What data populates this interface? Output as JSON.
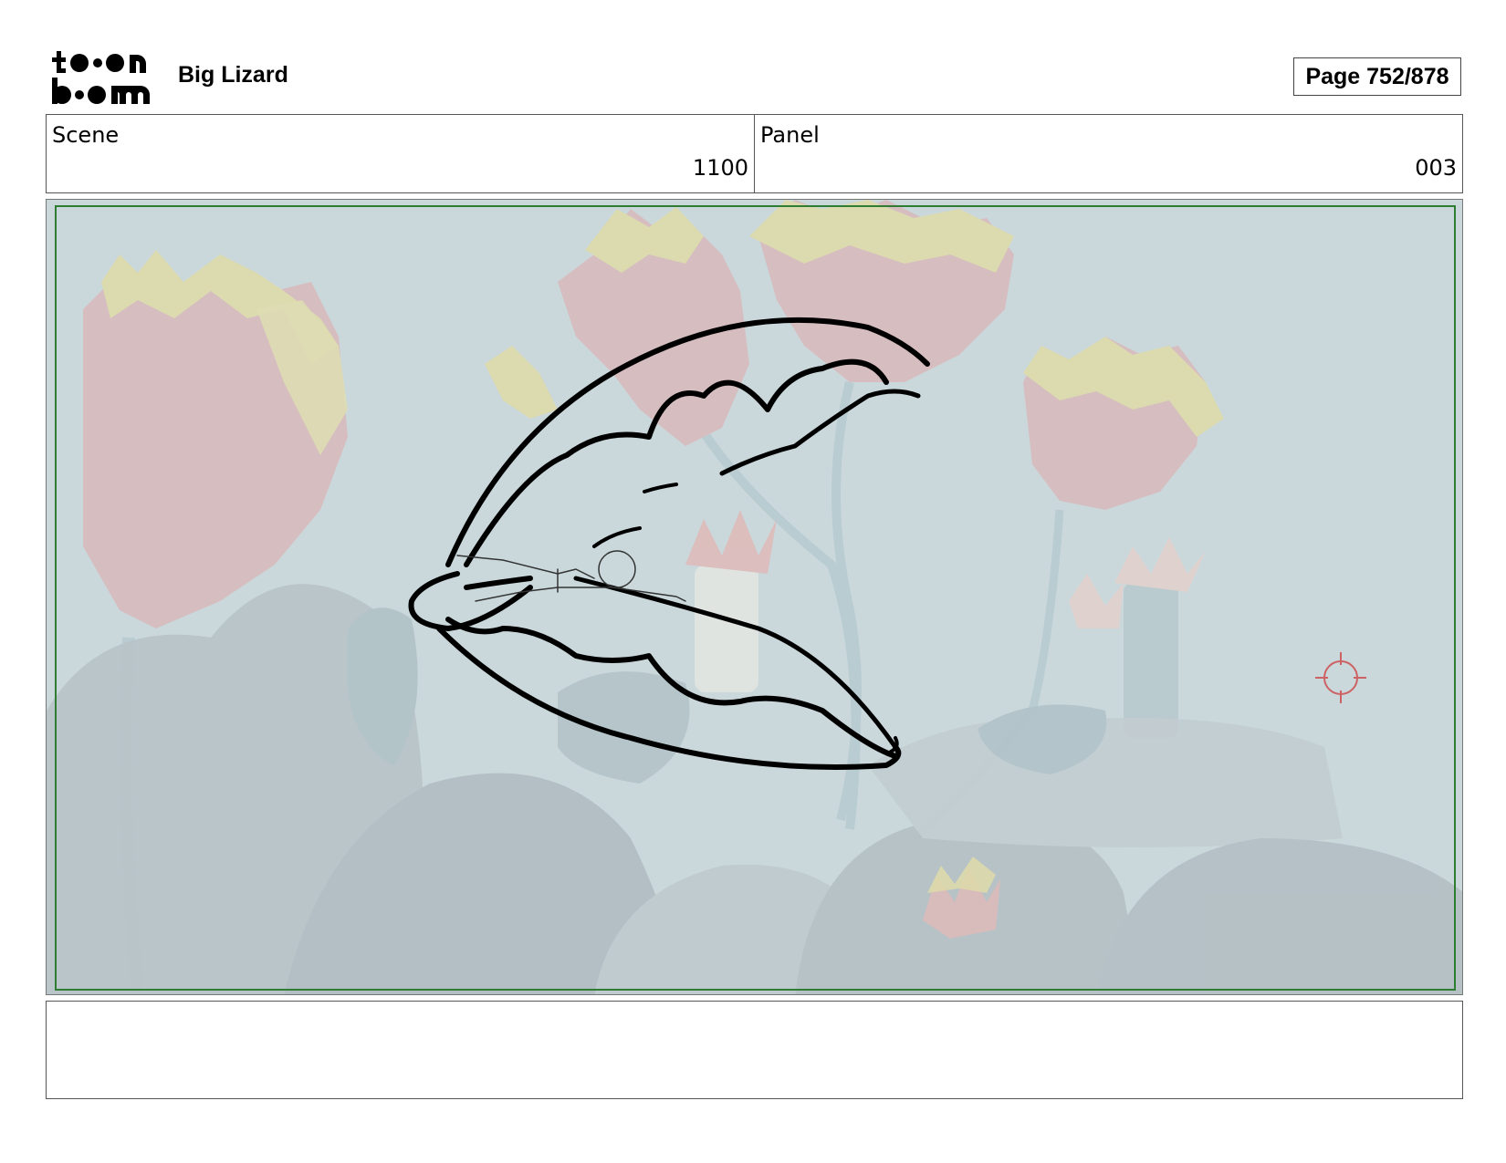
{
  "header": {
    "logo_text": "toon boom",
    "project_title": "Big Lizard",
    "page_label": "Page 752/878"
  },
  "scene": {
    "label": "Scene",
    "value": "1100"
  },
  "panel": {
    "label": "Panel",
    "value": "003"
  },
  "image": {
    "description_icon": "storyboard-panel-image",
    "safe_area_color": "#2e7d32",
    "sketch_color": "#000000"
  },
  "notes": {
    "text": ""
  }
}
